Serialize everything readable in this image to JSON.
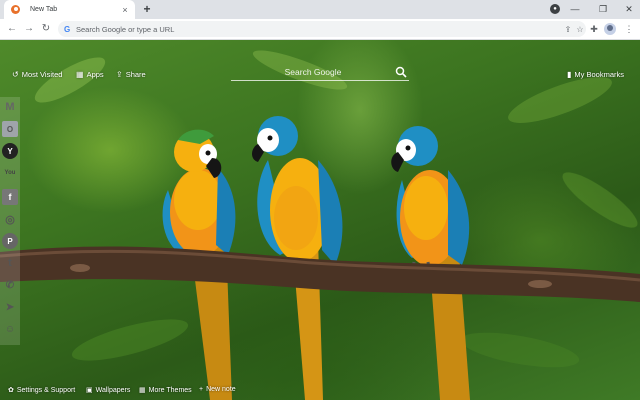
{
  "browser": {
    "tab_title": "New Tab",
    "tab_close": "×",
    "new_tab": "+",
    "omnibox_placeholder": "Search Google or type a URL",
    "omnibox_g": "G",
    "back": "←",
    "forward": "→",
    "reload": "↻",
    "share_glyph": "⇪",
    "star": "☆",
    "extensions": "✚",
    "menu": "⋮",
    "minimize": "—",
    "maximize": "❐",
    "close": "✕",
    "profile_badge": "●"
  },
  "top_nav": {
    "most_visited": {
      "label": "Most Visited",
      "icon": "↺"
    },
    "apps": {
      "label": "Apps",
      "icon": "▦"
    },
    "share": {
      "label": "Share",
      "icon": "⇪"
    },
    "bookmarks": {
      "label": "My Bookmarks",
      "icon": "▮"
    }
  },
  "search": {
    "placeholder": "Search Google",
    "icon": "search-icon"
  },
  "sidebar": {
    "items": [
      {
        "name": "gmail",
        "glyph": "M"
      },
      {
        "name": "outlook",
        "glyph": "O"
      },
      {
        "name": "yahoo",
        "glyph": "Y"
      },
      {
        "name": "youtube",
        "glyph": "You"
      },
      {
        "name": "facebook",
        "glyph": "f"
      },
      {
        "name": "instagram",
        "glyph": "◎"
      },
      {
        "name": "pinterest",
        "glyph": "P"
      },
      {
        "name": "twitter",
        "glyph": "t"
      },
      {
        "name": "whatsapp",
        "glyph": "✆"
      },
      {
        "name": "telegram",
        "glyph": "➤"
      },
      {
        "name": "reddit",
        "glyph": "☺"
      }
    ]
  },
  "bottom_bar": {
    "settings": {
      "label": "Settings & Support",
      "icon": "✿"
    },
    "wallpapers": {
      "label": "Wallpapers",
      "icon": "▣"
    },
    "more_themes": {
      "label": "More Themes",
      "icon": "▦"
    },
    "new_note": {
      "label": "New note",
      "icon": "+"
    }
  },
  "colors": {
    "macaw_blue": "#1f8fc4",
    "macaw_yellow": "#f6b00f",
    "macaw_orange": "#f29418",
    "branch": "#4a3324",
    "chrome_tabstrip": "#dee1e6"
  }
}
